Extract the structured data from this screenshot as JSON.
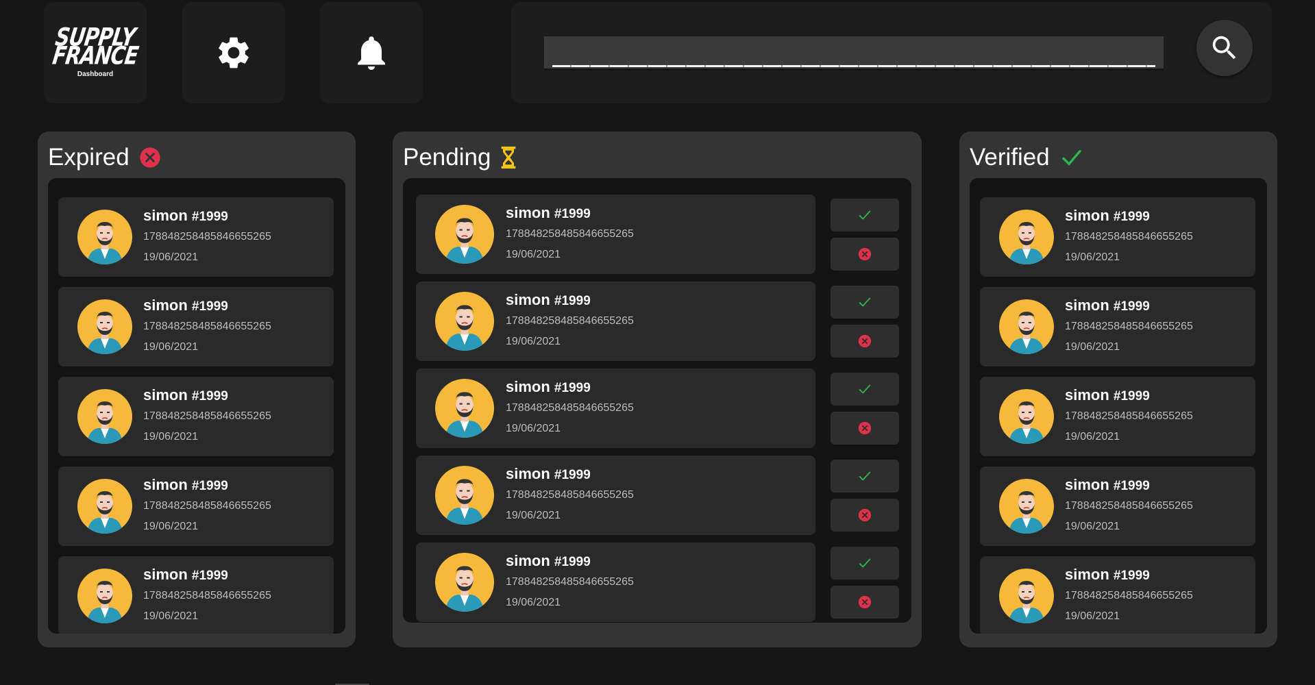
{
  "header": {
    "logo_line1": "SUPPLY",
    "logo_line2": "FRANCE",
    "logo_sub": "Dashboard",
    "settings_icon": "gear-icon",
    "notifications_icon": "bell-icon",
    "search_value": "",
    "search_icon": "search-icon"
  },
  "colors": {
    "background": "#161616",
    "panel": "#343434",
    "card": "#2a2a2a",
    "avatar_bg": "#f6b93b",
    "expired": "#e0314b",
    "pending": "#f5c518",
    "verified": "#2bb84a"
  },
  "columns": {
    "expired": {
      "title": "Expired",
      "icon": "x-circle-icon",
      "cards": [
        {
          "name": "simon",
          "tag": "#1999",
          "id": "178848258485846655265",
          "date": "19/06/2021"
        },
        {
          "name": "simon",
          "tag": "#1999",
          "id": "178848258485846655265",
          "date": "19/06/2021"
        },
        {
          "name": "simon",
          "tag": "#1999",
          "id": "178848258485846655265",
          "date": "19/06/2021"
        },
        {
          "name": "simon",
          "tag": "#1999",
          "id": "178848258485846655265",
          "date": "19/06/2021"
        },
        {
          "name": "simon",
          "tag": "#1999",
          "id": "178848258485846655265",
          "date": "19/06/2021"
        }
      ]
    },
    "pending": {
      "title": "Pending",
      "icon": "hourglass-icon",
      "approve_icon": "check-icon",
      "reject_icon": "x-circle-icon",
      "cards": [
        {
          "name": "simon",
          "tag": "#1999",
          "id": "178848258485846655265",
          "date": "19/06/2021"
        },
        {
          "name": "simon",
          "tag": "#1999",
          "id": "178848258485846655265",
          "date": "19/06/2021"
        },
        {
          "name": "simon",
          "tag": "#1999",
          "id": "178848258485846655265",
          "date": "19/06/2021"
        },
        {
          "name": "simon",
          "tag": "#1999",
          "id": "178848258485846655265",
          "date": "19/06/2021"
        },
        {
          "name": "simon",
          "tag": "#1999",
          "id": "178848258485846655265",
          "date": "19/06/2021"
        }
      ]
    },
    "verified": {
      "title": "Verified",
      "icon": "check-icon",
      "cards": [
        {
          "name": "simon",
          "tag": "#1999",
          "id": "178848258485846655265",
          "date": "19/06/2021"
        },
        {
          "name": "simon",
          "tag": "#1999",
          "id": "178848258485846655265",
          "date": "19/06/2021"
        },
        {
          "name": "simon",
          "tag": "#1999",
          "id": "178848258485846655265",
          "date": "19/06/2021"
        },
        {
          "name": "simon",
          "tag": "#1999",
          "id": "178848258485846655265",
          "date": "19/06/2021"
        },
        {
          "name": "simon",
          "tag": "#1999",
          "id": "178848258485846655265",
          "date": "19/06/2021"
        }
      ]
    }
  }
}
